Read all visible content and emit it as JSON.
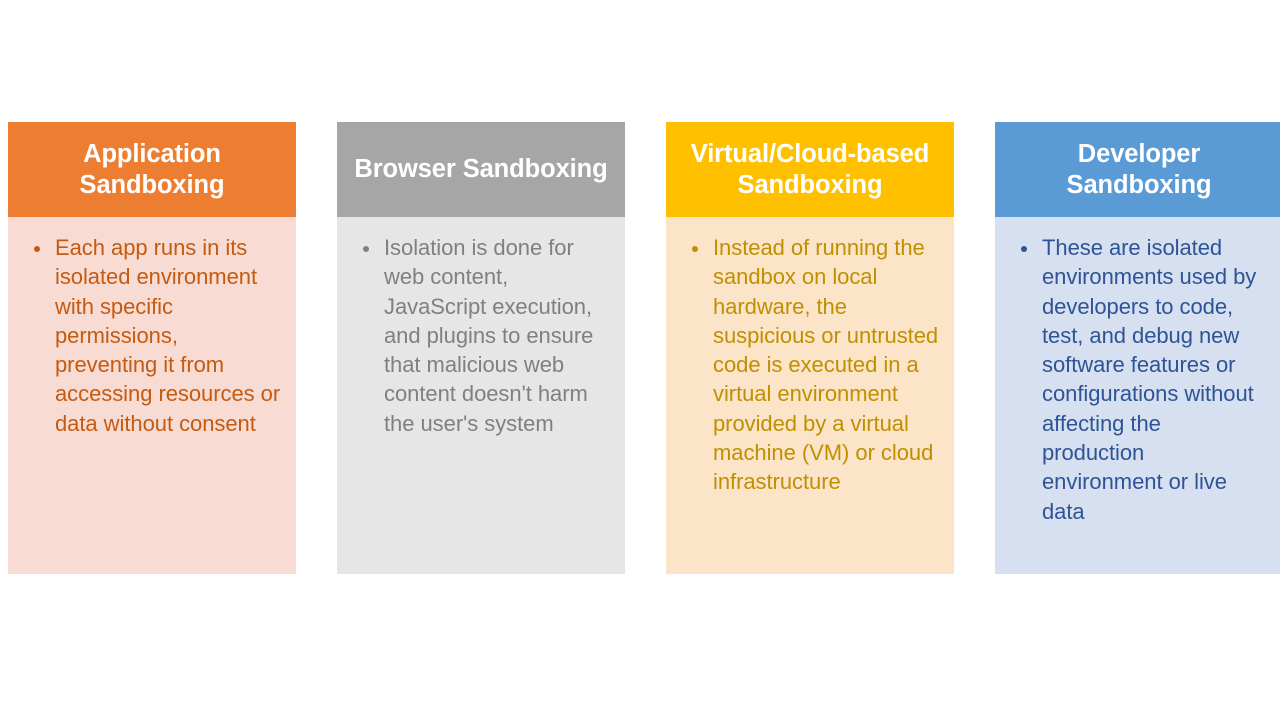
{
  "slide": {
    "background_color": "#FFFFFF",
    "cards": [
      {
        "id": "application-sandboxing",
        "title": "Application Sandboxing",
        "bullets": [
          "Each app runs in its isolated environment with specific permissions, preventing it from accessing resources or data without consent"
        ],
        "colors": {
          "header_bg": "#ED7D31",
          "body_bg": "#F8DCD3",
          "title_text": "#FFFFFF",
          "body_text": "#C55A11"
        }
      },
      {
        "id": "browser-sandboxing",
        "title": "Browser Sandboxing",
        "bullets": [
          "Isolation is done for web content, JavaScript execution, and plugins to ensure that malicious web content doesn't harm the user's system"
        ],
        "colors": {
          "header_bg": "#A6A6A6",
          "body_bg": "#E6E6E6",
          "title_text": "#FFFFFF",
          "body_text": "#808080"
        }
      },
      {
        "id": "virtual-cloud-based-sandboxing",
        "title": "Virtual/Cloud-based Sandboxing",
        "bullets": [
          "Instead of running the sandbox on local hardware, the suspicious or untrusted code is executed in a virtual environment provided by a virtual machine (VM) or cloud infrastructure"
        ],
        "colors": {
          "header_bg": "#FFC000",
          "body_bg": "#FCE4C8",
          "title_text": "#FFFFFF",
          "body_text": "#BF9000"
        }
      },
      {
        "id": "developer-sandboxing",
        "title": "Developer Sandboxing",
        "bullets": [
          "These are isolated environments used by developers to code, test, and debug new software features or configurations without affecting the production environment or live data"
        ],
        "colors": {
          "header_bg": "#5B9BD5",
          "body_bg": "#D6E0F0",
          "title_text": "#FFFFFF",
          "body_text": "#2E5496"
        }
      }
    ]
  }
}
